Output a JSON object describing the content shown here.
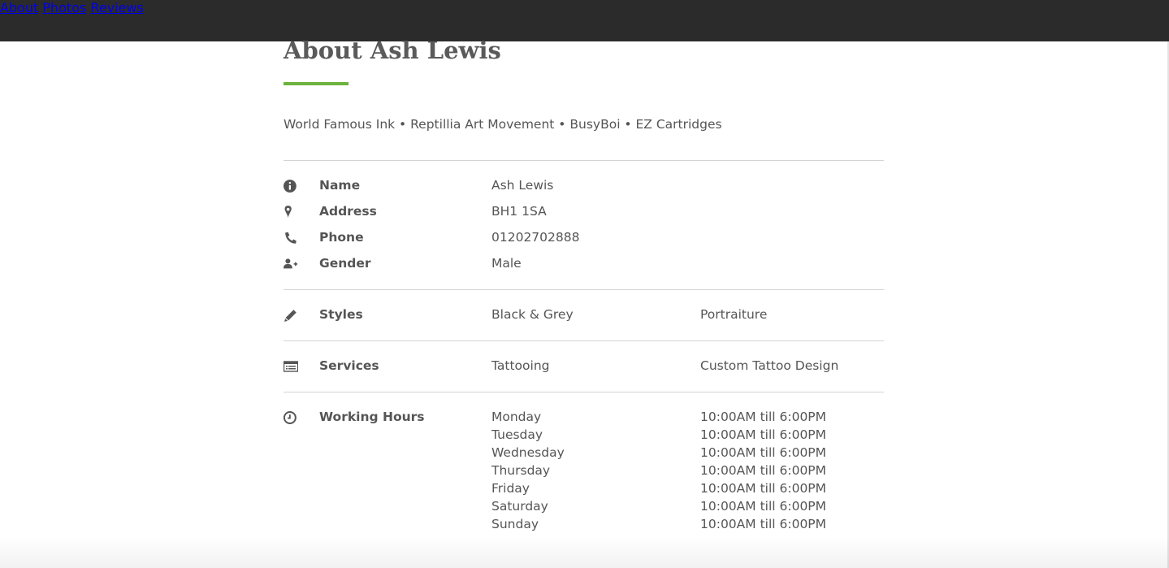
{
  "nav": {
    "about": "About",
    "photos": "Photos",
    "reviews": "Reviews"
  },
  "heading": "About Ash Lewis",
  "affiliations": "World Famous Ink • Reptillia Art Movement • BusyBoi • EZ Cartridges",
  "details": {
    "name": {
      "label": "Name",
      "value": "Ash Lewis",
      "icon": "info-circle-icon"
    },
    "address": {
      "label": "Address",
      "value": "BH1 1SA",
      "icon": "map-pin-icon"
    },
    "phone": {
      "label": "Phone",
      "value": "01202702888",
      "icon": "phone-icon"
    },
    "gender": {
      "label": "Gender",
      "value": "Male",
      "icon": "user-plus-icon"
    }
  },
  "styles": {
    "label": "Styles",
    "values": [
      "Black & Grey",
      "Portraiture"
    ],
    "icon": "pencil-icon"
  },
  "services": {
    "label": "Services",
    "values": [
      "Tattooing",
      "Custom Tattoo Design"
    ],
    "icon": "list-icon"
  },
  "working_hours": {
    "label": "Working Hours",
    "icon": "clock-icon",
    "days": [
      {
        "day": "Monday",
        "hours": "10:00AM till 6:00PM"
      },
      {
        "day": "Tuesday",
        "hours": "10:00AM till 6:00PM"
      },
      {
        "day": "Wednesday",
        "hours": "10:00AM till 6:00PM"
      },
      {
        "day": "Thursday",
        "hours": "10:00AM till 6:00PM"
      },
      {
        "day": "Friday",
        "hours": "10:00AM till 6:00PM"
      },
      {
        "day": "Saturday",
        "hours": "10:00AM till 6:00PM"
      },
      {
        "day": "Sunday",
        "hours": "10:00AM till 6:00PM"
      }
    ]
  },
  "colors": {
    "topbar": "#2b2b2b",
    "accent": "#6cb33e",
    "text": "#555555"
  }
}
